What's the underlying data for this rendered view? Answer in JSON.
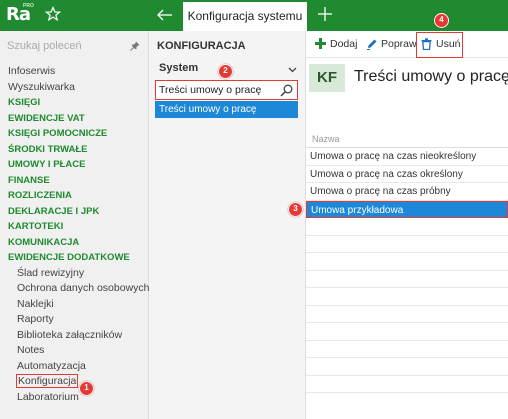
{
  "app": {
    "logo_text": "Ra",
    "logo_badge": "PRO",
    "active_tab": "Konfiguracja systemu"
  },
  "sidebar": {
    "search_placeholder": "Szukaj poleceń",
    "items": [
      {
        "label": "Infoserwis",
        "kind": "plain"
      },
      {
        "label": "Wyszukiwarka",
        "kind": "plain"
      },
      {
        "label": "KSIĘGI",
        "kind": "group"
      },
      {
        "label": "EWIDENCJE VAT",
        "kind": "group"
      },
      {
        "label": "KSIĘGI POMOCNICZE",
        "kind": "group"
      },
      {
        "label": "ŚRODKI TRWAŁE",
        "kind": "group"
      },
      {
        "label": "UMOWY I PŁACE",
        "kind": "group"
      },
      {
        "label": "FINANSE",
        "kind": "group"
      },
      {
        "label": "ROZLICZENIA",
        "kind": "group"
      },
      {
        "label": "DEKLARACJE I JPK",
        "kind": "group"
      },
      {
        "label": "KARTOTEKI",
        "kind": "group"
      },
      {
        "label": "KOMUNIKACJA",
        "kind": "group"
      },
      {
        "label": "EWIDENCJE DODATKOWE",
        "kind": "group"
      },
      {
        "label": "Ślad rewizyjny",
        "kind": "sub"
      },
      {
        "label": "Ochrona danych osobowych",
        "kind": "sub"
      },
      {
        "label": "Naklejki",
        "kind": "sub"
      },
      {
        "label": "Raporty",
        "kind": "sub"
      },
      {
        "label": "Biblioteka załączników",
        "kind": "sub"
      },
      {
        "label": "Notes",
        "kind": "sub"
      },
      {
        "label": "Automatyzacja",
        "kind": "sub"
      },
      {
        "label": "Konfiguracja",
        "kind": "sub"
      },
      {
        "label": "Laboratorium",
        "kind": "sub"
      }
    ]
  },
  "config": {
    "title": "KONFIGURACJA",
    "section": "System",
    "search_value": "Treści umowy o pracę",
    "result": "Treści umowy o pracę"
  },
  "toolbar": {
    "add": "Dodaj",
    "edit": "Popraw",
    "delete": "Usuń"
  },
  "document": {
    "badge": "KF",
    "title": "Treści umowy o pracę"
  },
  "table": {
    "header": "Nazwa",
    "rows": [
      "Umowa o pracę na czas nieokreślony",
      "Umowa o pracę na czas określony",
      "Umowa o pracę na czas próbny",
      "Umowa przykładowa"
    ]
  },
  "steps": [
    "1",
    "2",
    "3",
    "4"
  ],
  "colors": {
    "brand_green": "#1f8a2f",
    "selection_blue": "#1e88d8",
    "step_red": "#e53935"
  }
}
